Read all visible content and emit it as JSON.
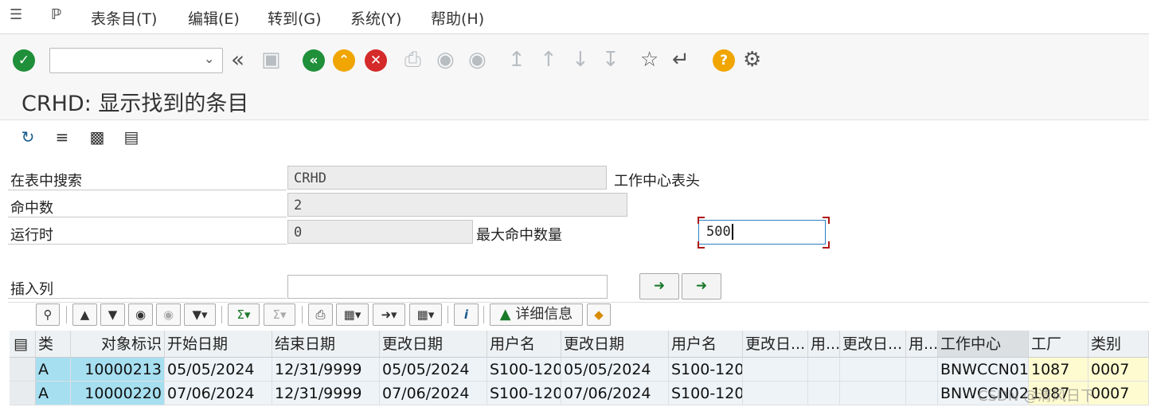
{
  "menu": {
    "items": [
      {
        "label": "表条目(T)"
      },
      {
        "label": "编辑(E)"
      },
      {
        "label": "转到(G)"
      },
      {
        "label": "系统(Y)"
      },
      {
        "label": "帮助(H)"
      }
    ]
  },
  "toolbar": {
    "command_field_value": "",
    "icons": [
      "enter-check-icon",
      "back-icon",
      "exit-icon",
      "cancel-icon",
      "print-icon",
      "find-icon",
      "find-next-icon",
      "first-page-icon",
      "prev-page-icon",
      "next-page-icon",
      "last-page-icon",
      "create-session-icon",
      "shortcut-icon",
      "help-icon",
      "settings-icon"
    ]
  },
  "title": "CRHD: 显示找到的条目",
  "form": {
    "search_in_table_label": "在表中搜索",
    "search_in_table_value": "CRHD",
    "search_in_table_desc": "工作中心表头",
    "hits_label": "命中数",
    "hits_value": "2",
    "runtime_label": "运行时",
    "runtime_value": "0",
    "max_hits_label": "最大命中数量",
    "max_hits_value": "500",
    "insert_column_label": "插入列",
    "insert_column_value": ""
  },
  "alv": {
    "detail_button_label": "详细信息"
  },
  "grid": {
    "columns": [
      "类",
      "对象标识",
      "开始日期",
      "结束日期",
      "更改日期",
      "用户名",
      "更改日期",
      "用户名",
      "更改日...",
      "用...",
      "更改日...",
      "用...",
      "工作中心",
      "工厂",
      "类别"
    ],
    "rows": [
      [
        "A",
        "10000213",
        "05/05/2024",
        "12/31/9999",
        "05/05/2024",
        "S100-120",
        "05/05/2024",
        "S100-120",
        "",
        "",
        "",
        "",
        "BNWCCN01",
        "1087",
        "0007"
      ],
      [
        "A",
        "10000220",
        "07/06/2024",
        "12/31/9999",
        "07/06/2024",
        "S100-120",
        "07/06/2024",
        "S100-120",
        "",
        "",
        "",
        "",
        "BNWCCN02",
        "1087",
        "0007"
      ]
    ]
  },
  "watermark": "CSDN @清风日下",
  "colors": {
    "key_column": "#a6dff0",
    "highlight_columns": "#fffbd0",
    "ok_green": "#1f8f3a",
    "exit_orange": "#f0a500",
    "cancel_red": "#d42a2a"
  }
}
